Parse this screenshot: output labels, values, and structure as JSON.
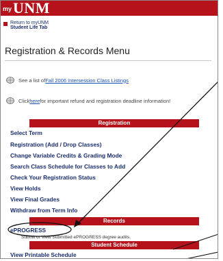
{
  "header": {
    "prefix": "my",
    "brand": "UNM"
  },
  "return_link": {
    "line1": "Return to myUNM",
    "line2": "Student Life Tab"
  },
  "page_title": "Registration & Records Menu",
  "info_lines": [
    {
      "prefix": "See a list of ",
      "link": "Fall 2006 Intersession Class Listings",
      "suffix": ""
    },
    {
      "prefix": "Click ",
      "link": "here",
      "suffix": " for important refund and registration deadline information!"
    }
  ],
  "sections": {
    "registration": {
      "title": "Registration",
      "items": [
        "Select Term",
        "Registration (Add / Drop Classes)",
        "Change Variable Credits & Grading Mode",
        "Search Class Schedule for Classes to Add",
        "Check Your Registration Status",
        "View Holds",
        "View Final Grades",
        "Withdraw from Term Info"
      ]
    },
    "records": {
      "title": "Records",
      "items": [
        "ePROGRESS"
      ],
      "note": "Submit or View Submitted ePROGRESS degree audits."
    },
    "student_schedule": {
      "title": "Student Schedule",
      "items": [
        "View Printable Schedule"
      ]
    }
  },
  "colors": {
    "brand_red": "#b5121b",
    "link_navy": "#1a2e6e",
    "link_blue": "#1a4fb0"
  }
}
